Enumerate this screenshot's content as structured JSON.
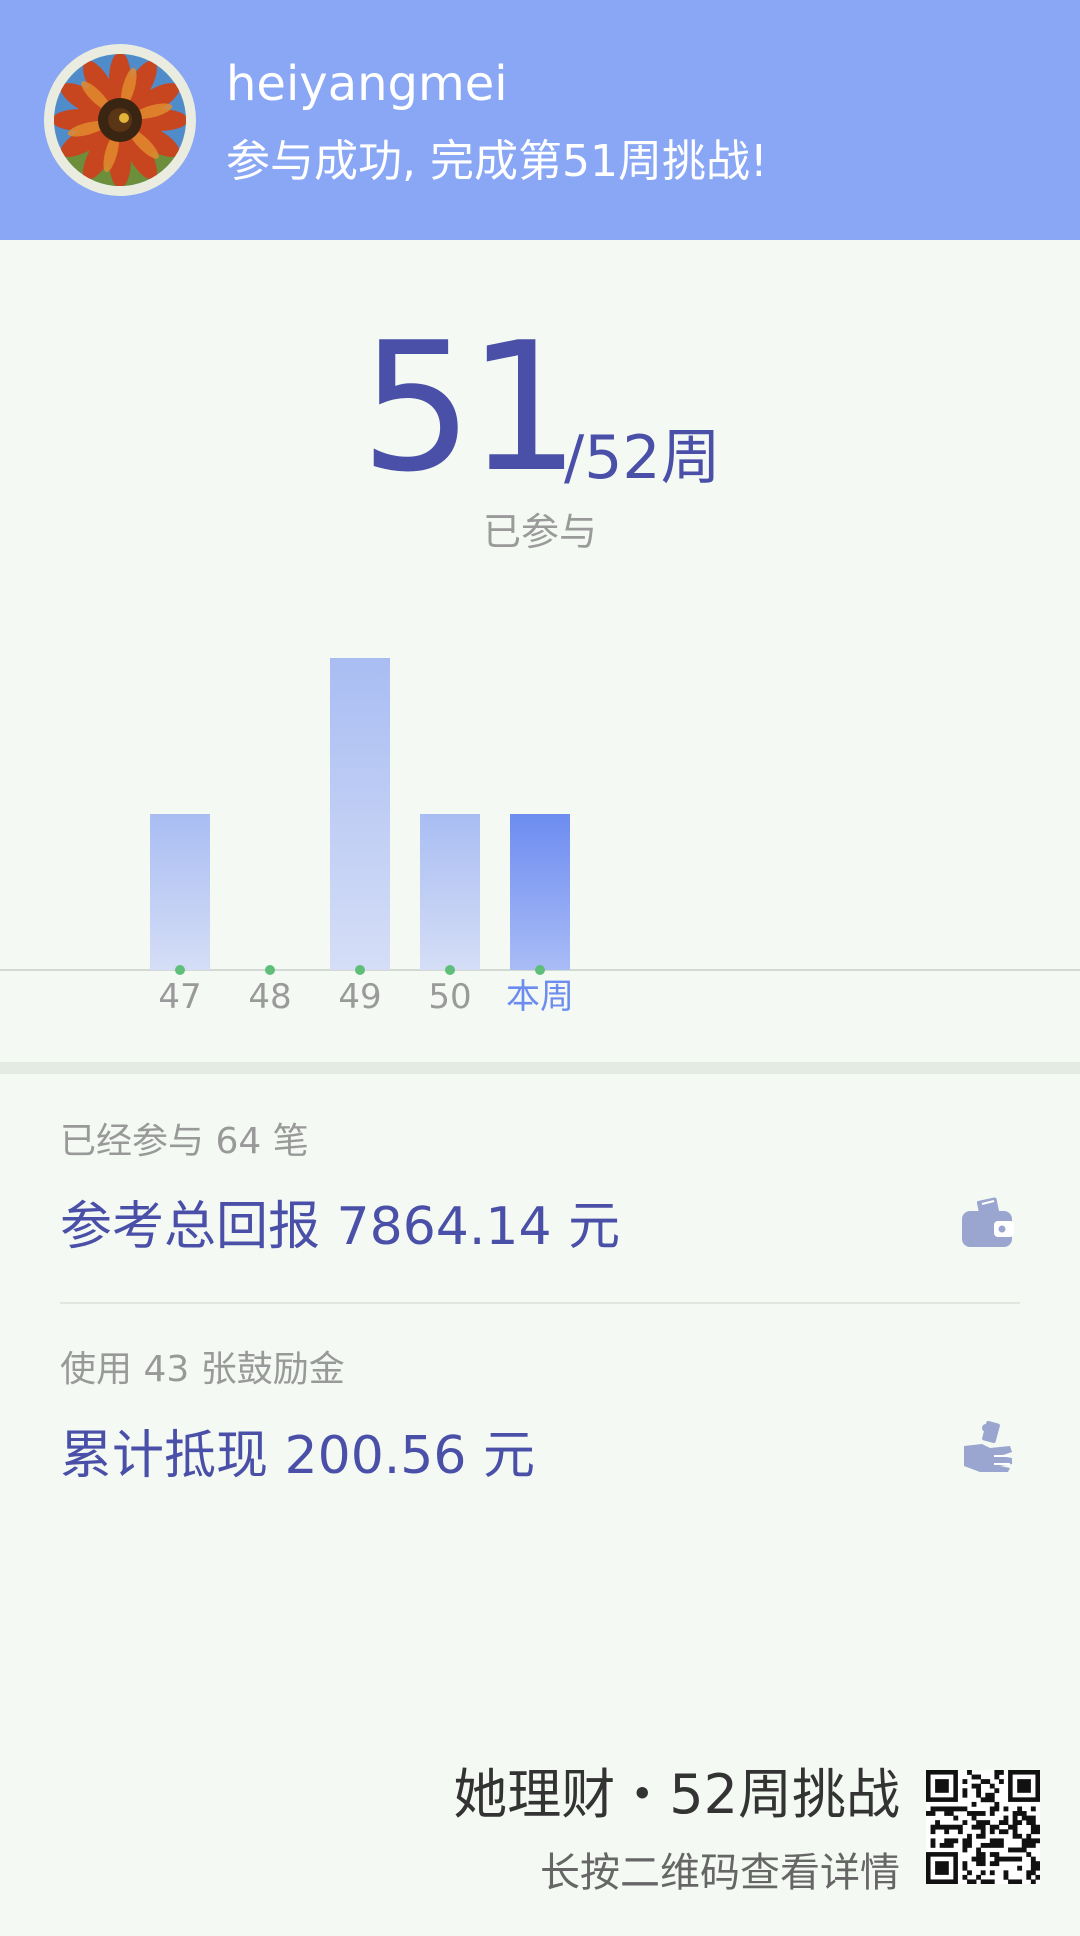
{
  "header": {
    "username": "heiyangmei",
    "message": "参与成功, 完成第51周挑战!",
    "avatar_icon": "sunflower-avatar"
  },
  "counter": {
    "value": "51",
    "total": "/52周",
    "caption": "已参与"
  },
  "chart_data": {
    "type": "bar",
    "categories": [
      "47",
      "48",
      "49",
      "50",
      "本周"
    ],
    "values": [
      1,
      0,
      2,
      1,
      1
    ],
    "ylim": [
      0,
      2
    ],
    "highlight_index": 4,
    "colors": {
      "bar": "#a9bdf3",
      "bar_light": "#d5def6",
      "highlight": "#6d8cf0",
      "highlight_light": "#a9bcf6",
      "tick_label": "#9a9a9a",
      "highlight_label": "#6d8cf0",
      "dot": "#5fbf7a"
    }
  },
  "stats": [
    {
      "sub": "已经参与 64 笔",
      "main": "参考总回报 7864.14 元",
      "icon": "wallet-icon"
    },
    {
      "sub": "使用 43 张鼓励金",
      "main": "累计抵现 200.56 元",
      "icon": "money-hand-icon"
    }
  ],
  "footer": {
    "title": "她理财・52周挑战",
    "hint": "长按二维码查看详情",
    "qr_icon": "qr-code"
  },
  "colors": {
    "header_bg": "#8aa7f5",
    "accent": "#4a4fa8",
    "page_bg": "#f4faf3"
  }
}
